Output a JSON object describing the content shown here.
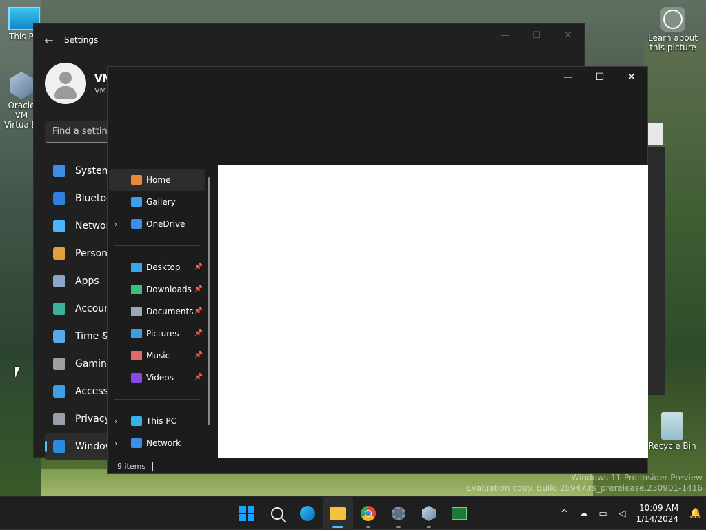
{
  "desktop": {
    "icons": {
      "this_pc": "This PC",
      "virtualbox": "Oracle VM VirtualBox",
      "learn": "Learn about this picture",
      "recycle": "Recycle Bin"
    },
    "watermark": {
      "line1": "Windows 11 Pro Insider Preview",
      "line2": "Evaluation copy. Build 25947.rs_prerelease.230901-1416"
    }
  },
  "settings": {
    "title": "Settings",
    "back_icon": "←",
    "profile_name": "VM",
    "profile_sub": "VM",
    "search_placeholder": "Find a setting",
    "nav": [
      {
        "label": "System",
        "color": "#3a8ee6"
      },
      {
        "label": "Bluetooth & devices",
        "color": "#2f7ee0"
      },
      {
        "label": "Network & internet",
        "color": "#4db2ff"
      },
      {
        "label": "Personalization",
        "color": "#e0a040"
      },
      {
        "label": "Apps",
        "color": "#8ba7c7"
      },
      {
        "label": "Accounts",
        "color": "#3bb39a"
      },
      {
        "label": "Time & language",
        "color": "#5aa8e8"
      },
      {
        "label": "Gaming",
        "color": "#a0a0a0"
      },
      {
        "label": "Accessibility",
        "color": "#3aa0e8"
      },
      {
        "label": "Privacy & security",
        "color": "#9aa0a8"
      },
      {
        "label": "Windows Update",
        "color": "#2a8ce0"
      }
    ],
    "sys_buttons": {
      "min": "—",
      "max": "☐",
      "close": "✕"
    }
  },
  "explorer": {
    "sys_buttons": {
      "min": "—",
      "max": "☐",
      "close": "✕"
    },
    "nav_top": [
      {
        "label": "Home",
        "color": "#e88a3a",
        "chevron": ""
      },
      {
        "label": "Gallery",
        "color": "#3aa0e8",
        "chevron": ""
      },
      {
        "label": "OneDrive",
        "color": "#3a8ee6",
        "chevron": "›"
      }
    ],
    "nav_pinned": [
      {
        "label": "Desktop",
        "color": "#3aa8e8"
      },
      {
        "label": "Downloads",
        "color": "#3ac07a"
      },
      {
        "label": "Documents",
        "color": "#9aa8b8"
      },
      {
        "label": "Pictures",
        "color": "#3a9ee0"
      },
      {
        "label": "Music",
        "color": "#e06a6a"
      },
      {
        "label": "Videos",
        "color": "#8a4ae0"
      }
    ],
    "pin_icon": "📌",
    "nav_bottom": [
      {
        "label": "This PC",
        "color": "#3ab0e8",
        "chevron": "›"
      },
      {
        "label": "Network",
        "color": "#3a8ee6",
        "chevron": "›"
      }
    ],
    "status": "9 items"
  },
  "taskbar": {
    "apps": [
      "start",
      "search",
      "edge-beta",
      "file-explorer",
      "chrome",
      "settings",
      "virtualbox",
      "task-manager"
    ],
    "tray": {
      "chevron": "^",
      "time": "10:09 AM",
      "date": "1/14/2024"
    }
  }
}
